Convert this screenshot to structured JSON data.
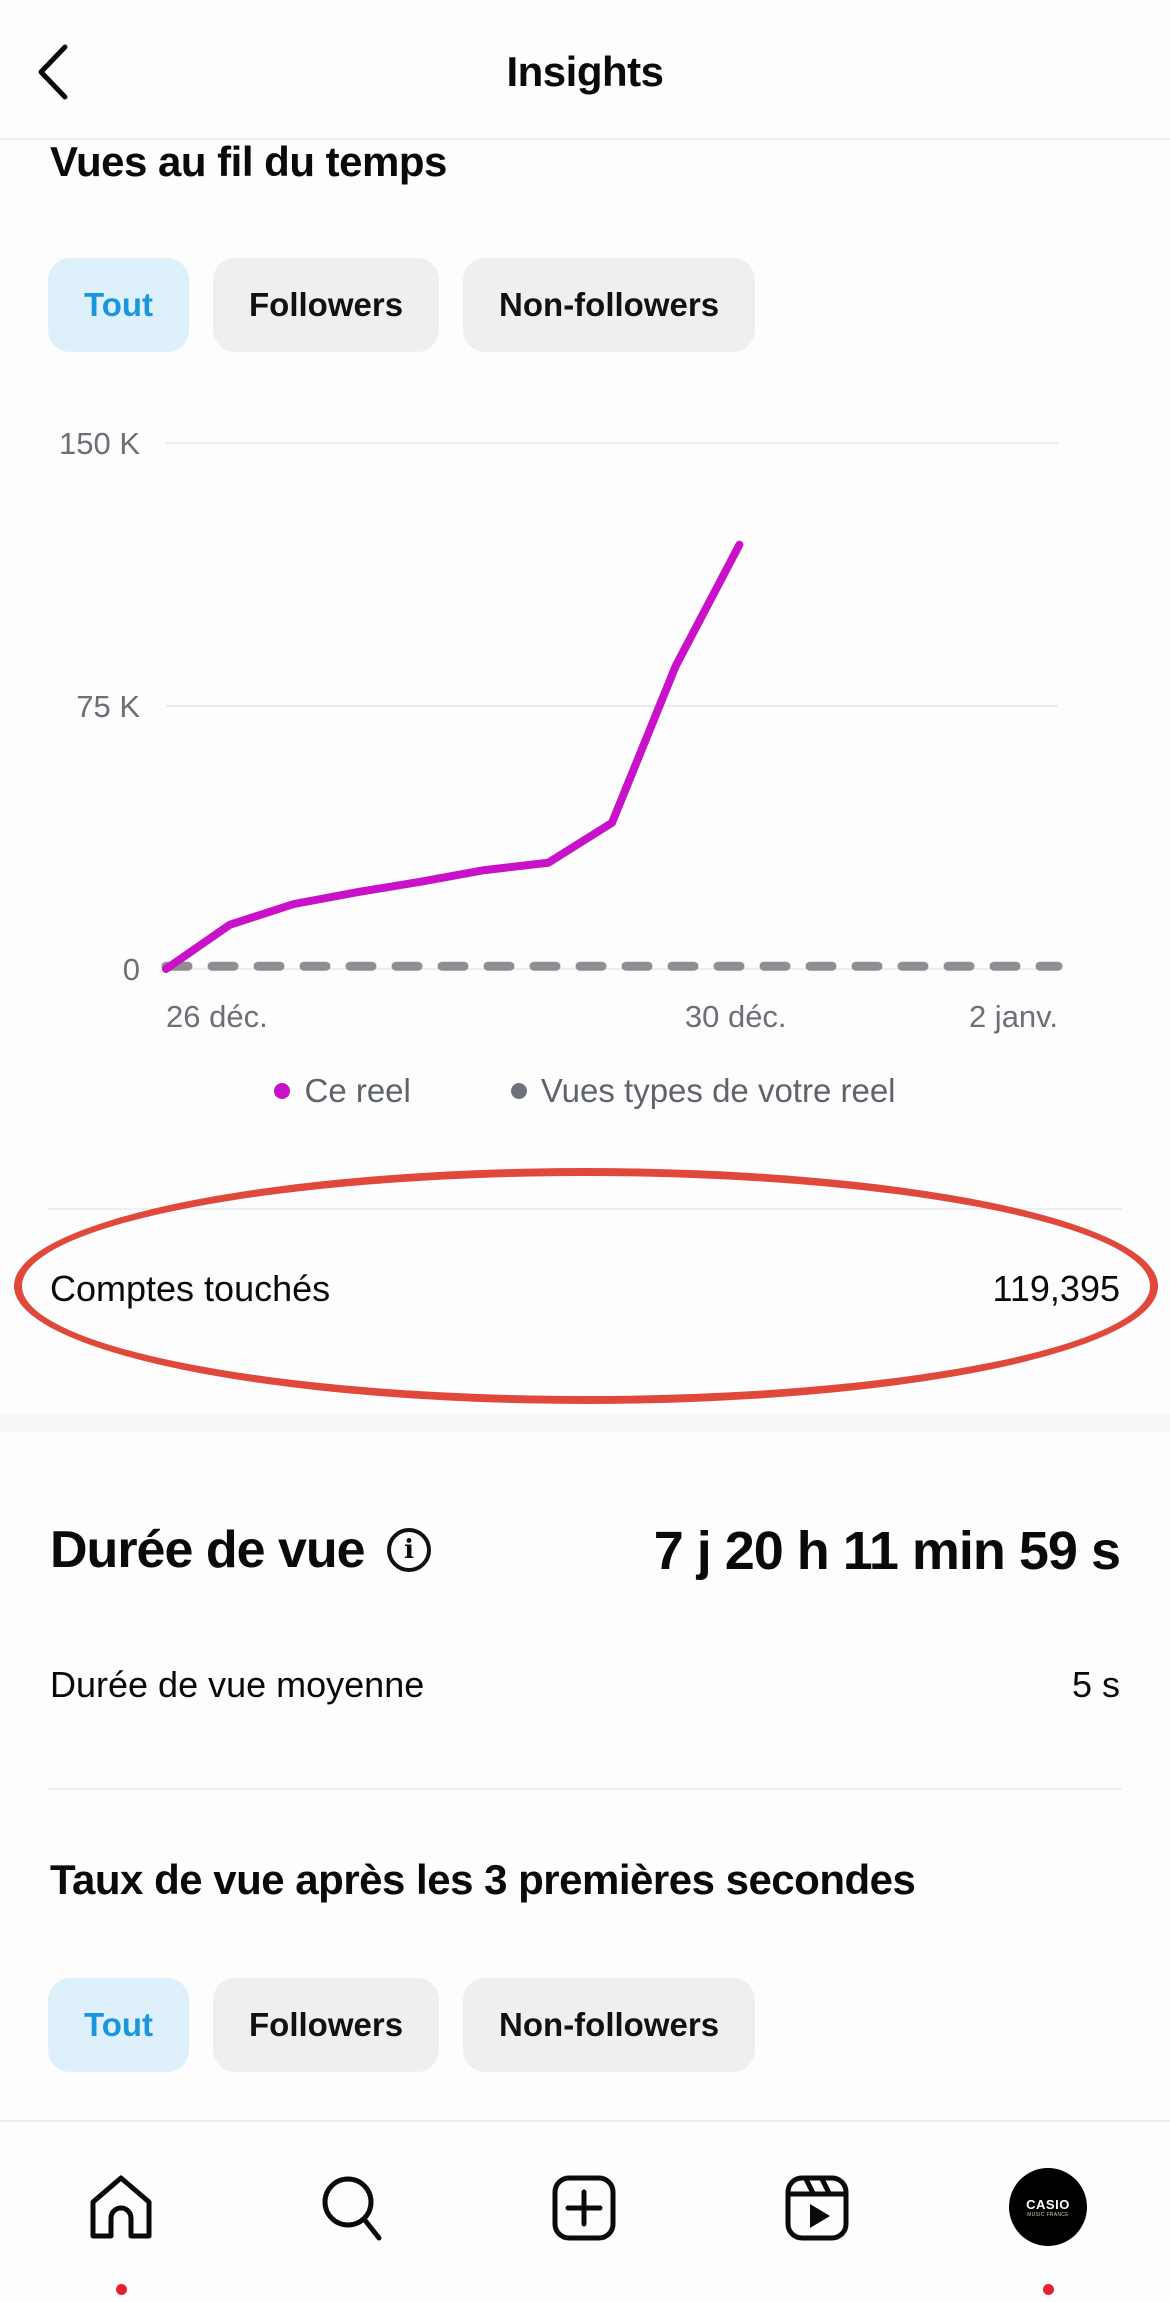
{
  "header": {
    "title": "Insights",
    "back_icon": "chevron-left-icon"
  },
  "views_section": {
    "title": "Vues au fil du temps",
    "filters": [
      {
        "label": "Tout",
        "active": true
      },
      {
        "label": "Followers",
        "active": false
      },
      {
        "label": "Non-followers",
        "active": false
      }
    ]
  },
  "chart_data": {
    "type": "line",
    "title": "Vues au fil du temps",
    "xlabel": "",
    "ylabel": "",
    "ylim": [
      0,
      150000
    ],
    "xlim_days": [
      0,
      7
    ],
    "y_ticks": [
      {
        "value": 0,
        "label": "0"
      },
      {
        "value": 75000,
        "label": "75 K"
      },
      {
        "value": 150000,
        "label": "150 K"
      }
    ],
    "x_ticks": [
      {
        "day": 0,
        "label": "26 déc."
      },
      {
        "day": 4,
        "label": "30 déc."
      },
      {
        "day": 7,
        "label": "2 janv."
      }
    ],
    "grid": true,
    "legend_position": "bottom-center",
    "series": [
      {
        "name": "Ce reel",
        "color": "#c811c8",
        "style": "solid",
        "x_days": [
          0,
          0.5,
          1.0,
          1.5,
          2.0,
          2.5,
          3.0,
          3.5,
          4.0,
          4.5
        ],
        "values": [
          0,
          12600,
          18500,
          21900,
          24900,
          28200,
          30300,
          41700,
          86400,
          121000
        ]
      },
      {
        "name": "Vues types de votre reel",
        "color": "#8e8e93",
        "legend_color": "#6e737b",
        "style": "dashed",
        "x_days": [
          0,
          7
        ],
        "values": [
          800,
          800
        ]
      }
    ]
  },
  "reach": {
    "label": "Comptes touchés",
    "value": "119,395",
    "highlight_color": "#e0483b"
  },
  "watch_time": {
    "title": "Durée de vue",
    "info_icon": "info-icon",
    "total": "7 j 20 h 11 min 59 s",
    "average_label": "Durée de vue moyenne",
    "average_value": "5 s"
  },
  "retention": {
    "title": "Taux de vue après les 3 premières secondes",
    "filters": [
      {
        "label": "Tout",
        "active": true
      },
      {
        "label": "Followers",
        "active": false
      },
      {
        "label": "Non-followers",
        "active": false
      }
    ]
  },
  "bottom_nav": {
    "items": [
      {
        "name": "home",
        "icon": "home-icon",
        "badge": true
      },
      {
        "name": "search",
        "icon": "search-icon",
        "badge": false
      },
      {
        "name": "create",
        "icon": "plus-square-icon",
        "badge": false
      },
      {
        "name": "reels",
        "icon": "reels-icon",
        "badge": false
      },
      {
        "name": "profile",
        "icon": "avatar",
        "badge": true
      }
    ],
    "avatar_text": "CASIO",
    "avatar_subtext": "MUSIC FRANCE",
    "badge_color": "#e8202e"
  },
  "colors": {
    "accent_blue": "#1b95e0",
    "active_pill_bg": "#dff0fd",
    "pill_bg": "#efeff2"
  }
}
